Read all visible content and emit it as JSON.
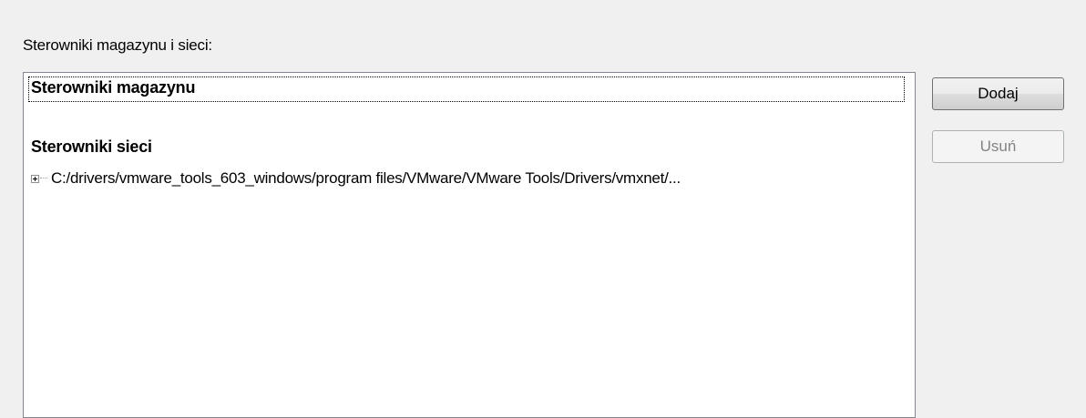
{
  "section_label": "Sterowniki magazynu i sieci:",
  "tree": {
    "groups": [
      {
        "label": "Sterowniki magazynu",
        "selected": true,
        "items": []
      },
      {
        "label": "Sterowniki sieci",
        "selected": false,
        "items": [
          {
            "label": "C:/drivers/vmware_tools_603_windows/program files/VMware/VMware Tools/Drivers/vmxnet/...",
            "expanded": false
          }
        ]
      }
    ]
  },
  "buttons": {
    "add_label": "Dodaj",
    "remove_label": "Usuń",
    "remove_enabled": false
  }
}
